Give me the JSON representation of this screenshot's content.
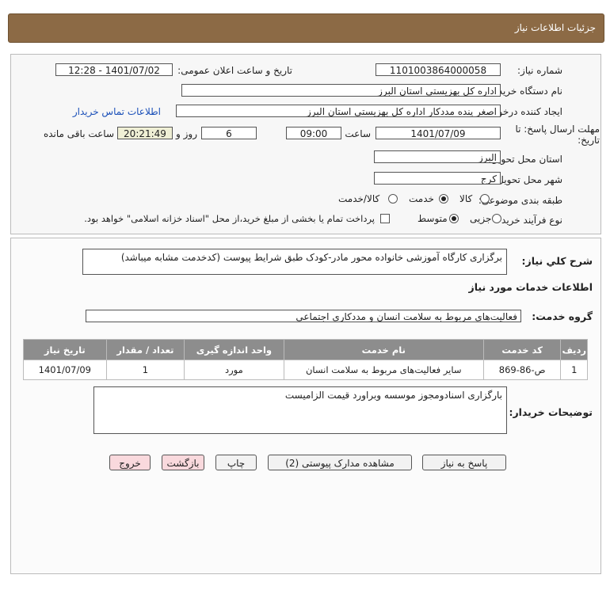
{
  "header": {
    "title": "جزئیات اطلاعات نیاز"
  },
  "fields": {
    "need_number_label": "شماره نیاز:",
    "need_number": "1101003864000058",
    "announce_label": "تاریخ و ساعت اعلان عمومی:",
    "announce_value": "1401/07/02 - 12:28",
    "buyer_org_label": "نام دستگاه خریدار:",
    "buyer_org": "اداره کل بهزیستی استان البرز",
    "requester_label": "ایجاد کننده درخواست:",
    "requester": "اصغر پنده مددکار اداره کل بهزیستی استان البرز",
    "contact_link": "اطلاعات تماس خریدار",
    "deadline_label": "مهلت ارسال پاسخ: تا تاریخ:",
    "deadline_date": "1401/07/09",
    "time_label": "ساعت",
    "deadline_time": "09:00",
    "days_value": "6",
    "days_label": "روز و",
    "remaining_time": "20:21:49",
    "remaining_label": "ساعت باقی مانده",
    "province_label": "استان محل تحویل:",
    "province": "البرز",
    "city_label": "شهر محل تحویل:",
    "city": "کرج",
    "category_label": "طبقه بندی موضوعی:",
    "category_options": [
      "کالا",
      "خدمت",
      "کالا/خدمت"
    ],
    "category_selected": "خدمت",
    "process_label": "نوع فرآیند خرید :",
    "process_options": [
      "جزیی",
      "متوسط"
    ],
    "process_selected": "متوسط",
    "payment_note": "پرداخت تمام یا بخشی از مبلغ خرید،از محل \"اسناد خزانه اسلامی\" خواهد بود."
  },
  "description": {
    "label": "شرح کلي نیاز:",
    "text": "برگزاری کارگاه آموزشی خانواده محور مادر-کودک طبق شرایط پیوست (کدخدمت مشابه میباشد)"
  },
  "services": {
    "section_title": "اطلاعات خدمات مورد نیاز",
    "group_label": "گروه خدمت:",
    "group_value": "فعالیت‌های مربوط به سلامت انسان و مددکاری اجتماعی",
    "columns": [
      "ردیف",
      "کد خدمت",
      "نام خدمت",
      "واحد اندازه گیری",
      "تعداد / مقدار",
      "تاریخ نیاز"
    ],
    "rows": [
      [
        "1",
        "ص-86-869",
        "سایر فعالیت‌های مربوط به سلامت انسان",
        "مورد",
        "1",
        "1401/07/09"
      ]
    ]
  },
  "buyer_notes": {
    "label": "توضیحات خریدار:",
    "text": "بارگزاری اسنادومجوز موسسه وبراورد قیمت الزامیست"
  },
  "buttons": {
    "reply": "پاسخ به نیاز",
    "attachments": "مشاهده مدارک پیوستی (2)",
    "print": "چاپ",
    "back": "بازگشت",
    "exit": "خروج"
  },
  "colors": {
    "header_bg": "#8c6a45",
    "table_header_bg": "#8d8d8d",
    "link": "#1a4fb8",
    "pink_button": "#f9d9dd"
  }
}
